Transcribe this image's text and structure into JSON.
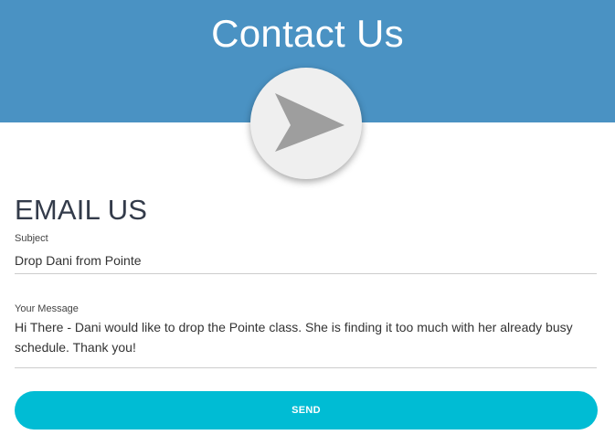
{
  "header": {
    "title": "Contact Us",
    "color": "#4a92c3",
    "badge_icon": "paper-plane-send-icon"
  },
  "form": {
    "section_title": "EMAIL US",
    "subject": {
      "label": "Subject",
      "value": "Drop Dani from Pointe"
    },
    "message": {
      "label": "Your Message",
      "value": "Hi There - Dani would like to drop the Pointe class. She is finding it too much with her already busy schedule. Thank you!"
    },
    "send_label": "SEND",
    "send_color": "#00bcd4"
  }
}
